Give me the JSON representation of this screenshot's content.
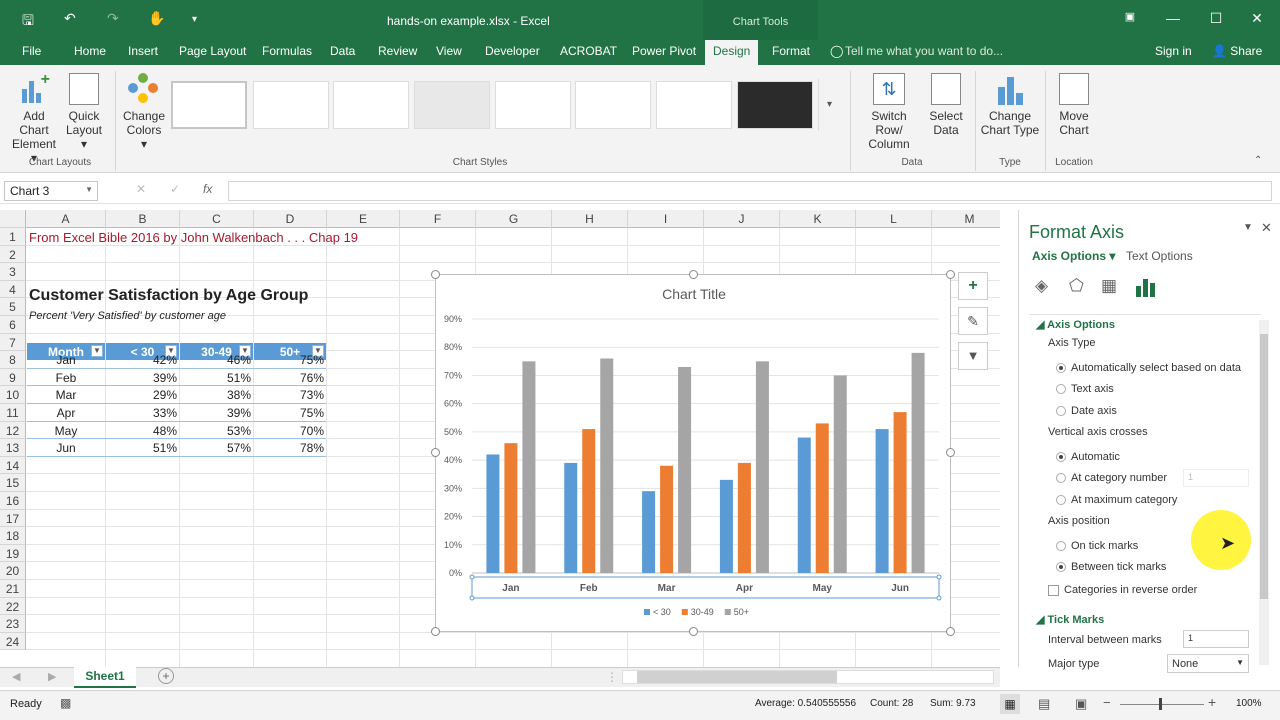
{
  "window": {
    "title": "hands-on example.xlsx - Excel",
    "context_tab": "Chart Tools"
  },
  "ribbon": {
    "tabs": [
      "File",
      "Home",
      "Insert",
      "Page Layout",
      "Formulas",
      "Data",
      "Review",
      "View",
      "Developer",
      "ACROBAT",
      "Power Pivot",
      "Design",
      "Format"
    ],
    "active_tab": "Design",
    "tell_me": "Tell me what you want to do...",
    "sign_in": "Sign in",
    "share": "Share",
    "add_chart_element": [
      "Add Chart",
      "Element"
    ],
    "quick_layout": [
      "Quick",
      "Layout"
    ],
    "change_colors": [
      "Change",
      "Colors"
    ],
    "switch_row_column": [
      "Switch Row/",
      "Column"
    ],
    "select_data": [
      "Select",
      "Data"
    ],
    "change_chart_type": [
      "Change",
      "Chart Type"
    ],
    "move_chart": [
      "Move",
      "Chart"
    ],
    "groups": {
      "chart_layouts": "Chart Layouts",
      "chart_styles": "Chart Styles",
      "data": "Data",
      "type": "Type",
      "location": "Location"
    }
  },
  "formula_bar": {
    "name_box": "Chart 3",
    "fx": "fx"
  },
  "columns": [
    "A",
    "B",
    "C",
    "D",
    "E",
    "F",
    "G",
    "H",
    "I",
    "J",
    "K",
    "L",
    "M"
  ],
  "rows": [
    "1",
    "2",
    "3",
    "4",
    "5",
    "6",
    "7",
    "8",
    "9",
    "10",
    "11",
    "12",
    "13",
    "14",
    "15",
    "16",
    "17",
    "18",
    "19",
    "20",
    "21",
    "22",
    "23",
    "24"
  ],
  "sheet": {
    "a1": "From Excel Bible 2016 by John Walkenbach . . . Chap 19",
    "a4": "Customer Satisfaction by Age Group",
    "a5": "Percent 'Very Satisfied' by customer age",
    "table_headers": [
      "Month",
      "< 30",
      "30-49",
      "50+"
    ],
    "table_rows": [
      [
        "Jan",
        "42%",
        "46%",
        "75%"
      ],
      [
        "Feb",
        "39%",
        "51%",
        "76%"
      ],
      [
        "Mar",
        "29%",
        "38%",
        "73%"
      ],
      [
        "Apr",
        "33%",
        "39%",
        "75%"
      ],
      [
        "May",
        "48%",
        "53%",
        "70%"
      ],
      [
        "Jun",
        "51%",
        "57%",
        "78%"
      ]
    ]
  },
  "chart_data": {
    "type": "bar",
    "title": "Chart Title",
    "categories": [
      "Jan",
      "Feb",
      "Mar",
      "Apr",
      "May",
      "Jun"
    ],
    "series": [
      {
        "name": "< 30",
        "color": "#5b9bd5",
        "values": [
          42,
          39,
          29,
          33,
          48,
          51
        ]
      },
      {
        "name": "30-49",
        "color": "#ed7d31",
        "values": [
          46,
          51,
          38,
          39,
          53,
          57
        ]
      },
      {
        "name": "50+",
        "color": "#a5a5a5",
        "values": [
          75,
          76,
          73,
          75,
          70,
          78
        ]
      }
    ],
    "yticks": [
      "0%",
      "10%",
      "20%",
      "30%",
      "40%",
      "50%",
      "60%",
      "70%",
      "80%",
      "90%"
    ],
    "ylim": [
      0,
      90
    ],
    "legend": "bottom",
    "grid": true
  },
  "pane": {
    "title": "Format Axis",
    "tab_axis": "Axis Options",
    "tab_text": "Text Options",
    "section_axis_options": "Axis Options",
    "axis_type": "Axis Type",
    "auto_select": "Automatically select based on data",
    "text_axis": "Text axis",
    "date_axis": "Date axis",
    "vertical_crosses": "Vertical axis crosses",
    "automatic": "Automatic",
    "at_category": "At category number",
    "at_category_value": "1",
    "at_max": "At maximum category",
    "axis_position": "Axis position",
    "on_tick": "On tick marks",
    "between_tick": "Between tick marks",
    "reverse_order": "Categories in reverse order",
    "section_tick_marks": "Tick Marks",
    "interval": "Interval between marks",
    "interval_value": "1",
    "major_type": "Major type",
    "major_value": "None"
  },
  "sheet_tab": "Sheet1",
  "status": {
    "ready": "Ready",
    "average": "Average: 0.540555556",
    "count": "Count: 28",
    "sum": "Sum: 9.73",
    "zoom": "100%"
  }
}
